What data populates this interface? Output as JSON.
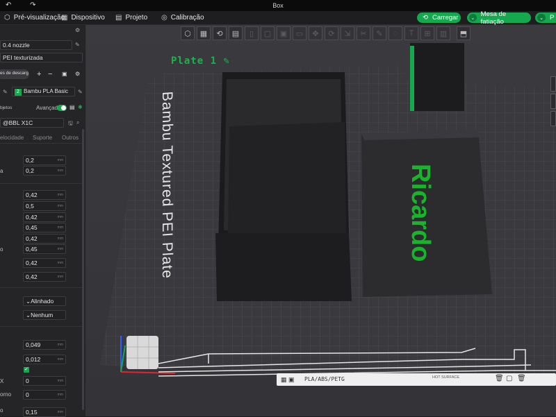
{
  "window": {
    "title": "Box"
  },
  "topbar": {
    "preview": "Pré-visualização",
    "device": "Dispositivo",
    "project": "Projeto",
    "calibration": "Calibração",
    "load_button": "Carregar",
    "slice_plate_button": "Mesa de fatiação",
    "print_button": "P"
  },
  "sidebar": {
    "nozzle": "0.4 nozzle",
    "plate_type": "PEI texturizada",
    "filament_header": "es de descarga",
    "filament_index": "2",
    "filament_name": "Bambu PLA Basic",
    "objects_label": "bjetos",
    "advanced_label": "Avançado",
    "process_profile": "@BBL X1C",
    "tabs": [
      "elocidade",
      "Suporte",
      "Outros"
    ],
    "unit": "mm",
    "layer_values": [
      {
        "label": "",
        "value": "0,2"
      },
      {
        "label": "a",
        "value": "0,2"
      }
    ],
    "width_values": [
      "0,42",
      "0,5",
      "0,42",
      "0,45",
      "0,42",
      "0,45",
      "0,42",
      "0,42"
    ],
    "width_label_o": "o",
    "seam_value": "Alinhado",
    "none_value": "Nenhum",
    "precision_values": [
      "0,049",
      "0,012"
    ],
    "x_label": "X",
    "x_value": "0",
    "orno_label": "orno",
    "orno_value": "0",
    "bottom_label": "o",
    "bottom_value": "0,15"
  },
  "viewport": {
    "plate_label": "Plate 1",
    "bed_text": "Bambu Textured PEI Plate",
    "model_text": "Ricardo",
    "filament_types": "PLA/ABS/PETG",
    "hot_surface": "HOT SURFACE"
  },
  "colors": {
    "accent": "#15a84f",
    "model_text": "#18b42a",
    "bed": "#3a3a3e"
  }
}
